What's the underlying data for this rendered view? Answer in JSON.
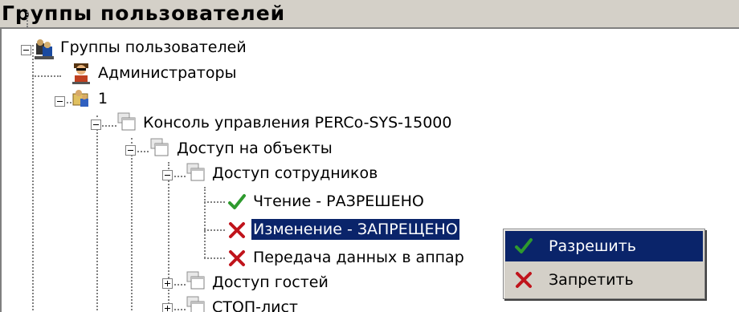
{
  "panel": {
    "title": "Группы пользователей"
  },
  "tree": {
    "root": {
      "label": "Группы пользователей",
      "icon": "user-groups-icon"
    },
    "admins": {
      "label": "Администраторы",
      "icon": "admin-user-icon"
    },
    "group1": {
      "label": "1",
      "icon": "user-group-icon"
    },
    "console": {
      "label": "Консоль управления PERCo-SYS-15000",
      "icon": "window-folder-icon"
    },
    "objects_access": {
      "label": "Доступ на объекты",
      "icon": "window-folder-icon"
    },
    "employees_access": {
      "label": "Доступ сотрудников",
      "icon": "window-folder-icon"
    },
    "read": {
      "label": "Чтение  -  РАЗРЕШЕНО",
      "icon": "check-icon",
      "state": "allowed"
    },
    "change": {
      "label": "Изменение  -  ЗАПРЕЩЕНО",
      "icon": "cross-icon",
      "state": "denied"
    },
    "transfer": {
      "label": "Передача данных в аппар",
      "icon": "cross-icon",
      "state": "denied"
    },
    "guests_access": {
      "label": "Доступ гостей",
      "icon": "window-folder-icon"
    },
    "stop_list": {
      "label": "СТОП-лист",
      "icon": "window-folder-icon"
    }
  },
  "context_menu": {
    "items": [
      {
        "label": "Разрешить",
        "icon": "check-icon",
        "highlighted": true
      },
      {
        "label": "Запретить",
        "icon": "cross-icon",
        "highlighted": false
      }
    ]
  },
  "colors": {
    "selection": "#0a246a",
    "check": "#2e9a2e",
    "cross": "#c0141c",
    "header_bg": "#d4d0c8"
  }
}
